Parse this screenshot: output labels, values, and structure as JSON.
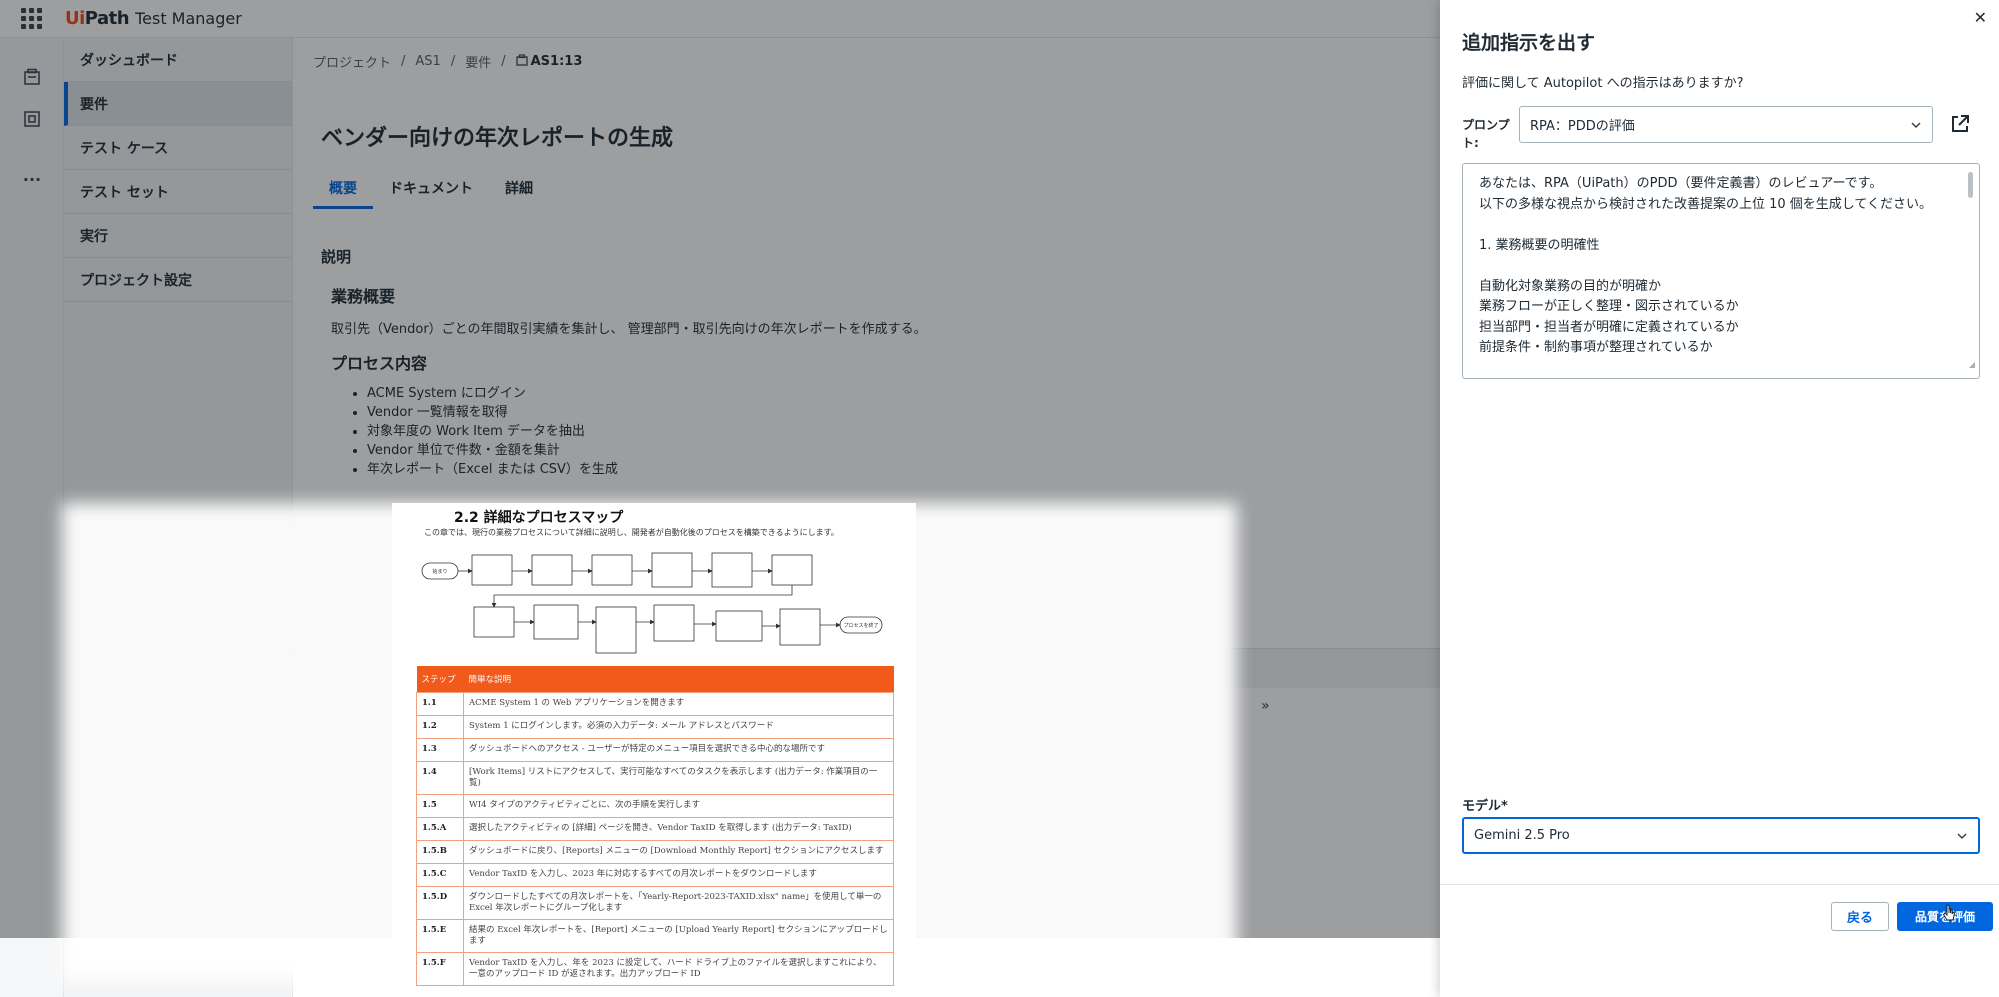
{
  "app": {
    "logo_prefix": "Ui",
    "logo_suffix": "Path",
    "product": "Test Manager"
  },
  "nav": {
    "items": [
      {
        "label": "ダッシュボード"
      },
      {
        "label": "要件"
      },
      {
        "label": "テスト ケース"
      },
      {
        "label": "テスト セット"
      },
      {
        "label": "実行"
      },
      {
        "label": "プロジェクト設定"
      }
    ]
  },
  "breadcrumb": {
    "items": [
      "プロジェクト",
      "AS1",
      "要件"
    ],
    "current": "AS1:13"
  },
  "page": {
    "title": "ベンダー向けの年次レポートの生成",
    "tabs": [
      "概要",
      "ドキュメント",
      "詳細"
    ],
    "section_label": "説明",
    "overview_heading": "業務概要",
    "overview_text": "取引先（Vendor）ごとの年間取引実績を集計し、 管理部門・取引先向けの年次レポートを作成する。",
    "process_heading": "プロセス内容",
    "process_items": [
      "ACME System にログイン",
      "Vendor 一覧情報を取得",
      "対象年度の Work Item データを抽出",
      "Vendor 単位で件数・金額を集計",
      "年次レポート（Excel または CSV）を生成"
    ]
  },
  "document_preview": {
    "title": "2.2 詳細なプロセスマップ",
    "subtitle": "この章では、現行の業務プロセスについて詳細に説明し、開発者が自動化後のプロセスを構築できるようにします。",
    "flow_start": "始まり",
    "flow_end": "プロセスを終了",
    "table_headers": [
      "ステップ",
      "簡単な説明"
    ],
    "table_rows": [
      {
        "step": "1.1",
        "desc": "ACME System 1 の Web アプリケーションを開きます"
      },
      {
        "step": "1.2",
        "desc": "System 1 にログインします。必須の入力データ: メール アドレスとパスワード"
      },
      {
        "step": "1.3",
        "desc": "ダッシュボードへのアクセス - ユーザーが特定のメニュー項目を選択できる中心的な場所です"
      },
      {
        "step": "1.4",
        "desc": "[Work Items] リストにアクセスして、実行可能なすべてのタスクを表示します (出力データ: 作業項目の一覧)"
      },
      {
        "step": "1.5",
        "desc": "WI4 タイプのアクティビティごとに、次の手順を実行します"
      },
      {
        "step": "1.5.A",
        "desc": "選択したアクティビティの [詳細] ページを開き、Vendor TaxID を取得します (出力データ: TaxID)"
      },
      {
        "step": "1.5.B",
        "desc": "ダッシュボードに戻り、[Reports] メニューの [Download Monthly Report] セクションにアクセスします"
      },
      {
        "step": "1.5.C",
        "desc": "Vendor TaxID を入力し、2023 年に対応するすべての月次レポートをダウンロードします"
      },
      {
        "step": "1.5.D",
        "desc": "ダウンロードしたすべての月次レポートを、「Yearly-Report-2023-TAXID.xlsx\" name」を使用して単一の Excel 年次レポートにグループ化します"
      },
      {
        "step": "1.5.E",
        "desc": "結果の Excel 年次レポートを、[Report] メニューの [Upload Yearly Report] セクションにアップロードします"
      },
      {
        "step": "1.5.F",
        "desc": "Vendor TaxID を入力し、年を 2023 に設定して、ハード ドライブ上のファイルを選択しますこれにより、一意のアップロード ID が返されます。出力アップロード ID"
      }
    ]
  },
  "drawer": {
    "title": "追加指示を出す",
    "question": "評価に関して Autopilot への指示はありますか?",
    "prompt_label": "プロンプト:",
    "prompt_selected": "RPA：PDDの評価",
    "prompt_lines": [
      "あなたは、RPA（UiPath）のPDD（要件定義書）のレビュアーです。",
      "以下の多様な視点から検討された改善提案の上位 10 個を生成してください。",
      "",
      "1. 業務概要の明確性",
      "",
      "自動化対象業務の目的が明確か",
      "業務フローが正しく整理・図示されているか",
      "担当部門・担当者が明確に定義されているか",
      "前提条件・制約事項が整理されているか"
    ],
    "model_label": "モデル*",
    "model_selected": "Gemini 2.5 Pro",
    "back_label": "戻る",
    "evaluate_label": "品質を評価"
  },
  "icons": {
    "apps": "apps-grid-icon",
    "close": "close-icon",
    "open_external": "open-external-icon",
    "chevron": "chevron-down-icon"
  },
  "colors": {
    "accent": "#0067df",
    "brand": "#fa4616",
    "doc_table_header": "#f25a1c"
  }
}
